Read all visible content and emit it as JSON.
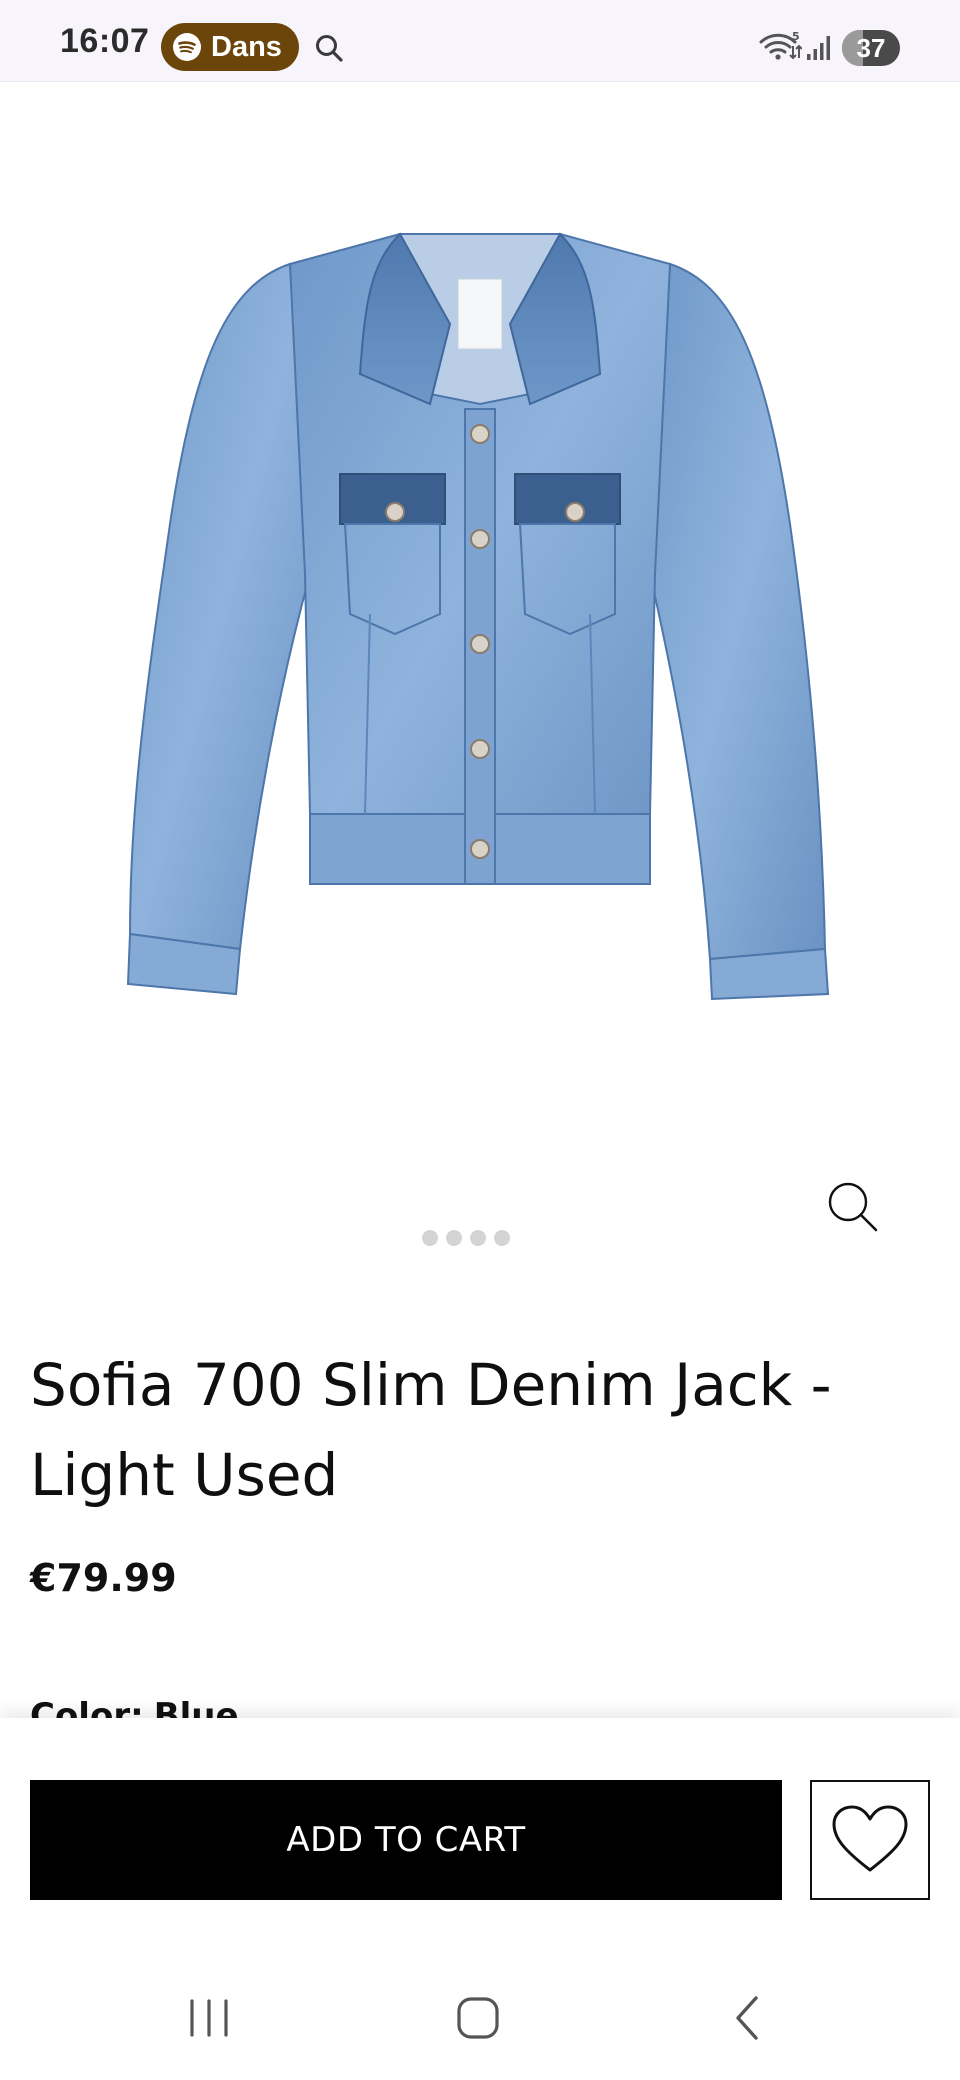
{
  "status_bar": {
    "time": "16:07",
    "media_pill": {
      "label": "Dans",
      "icon": "spotify-icon",
      "color": "#6b4509"
    },
    "search_icon": "search-icon",
    "wifi_icon": "wifi-icon",
    "signal_icon": "signal-icon",
    "battery": {
      "level": 37,
      "text": "37"
    }
  },
  "product": {
    "image_alt_icon": "denim-jacket-image",
    "zoom_icon": "magnifier-icon",
    "carousel": {
      "dot_count": 4,
      "active_index": 0
    },
    "title": "Sofia 700 Slim Denim Jack - Light Used",
    "price": "€79.99",
    "color_label": "Color:",
    "color_value": "Blue"
  },
  "actions": {
    "add_to_cart_label": "ADD TO CART",
    "wishlist_icon": "heart-icon"
  },
  "nav": {
    "recents_icon": "recents-icon",
    "home_icon": "home-icon",
    "back_icon": "back-icon"
  },
  "colors": {
    "status_bar_bg": "#f7f4fb",
    "primary_button": "#000000",
    "denim": "#82a9d6"
  }
}
